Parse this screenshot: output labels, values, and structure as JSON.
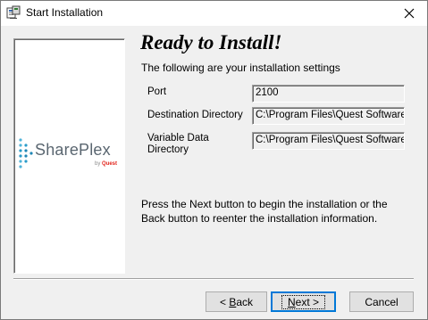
{
  "window": {
    "title": "Start Installation",
    "close_icon": "close-icon",
    "app_icon": "installer-icon"
  },
  "brand": {
    "name": "SharePlex",
    "by": "by",
    "company": "Quest"
  },
  "main": {
    "heading": "Ready to Install!",
    "subheading": "The following are your installation settings",
    "fields": [
      {
        "label": "Port",
        "value": "2100"
      },
      {
        "label": "Destination Directory",
        "value": "C:\\Program Files\\Quest Software\\SharePlex"
      },
      {
        "label": "Variable Data Directory",
        "value": "C:\\Program Files\\Quest Software\\SharePlex"
      }
    ],
    "instructions": "Press the Next button to begin the installation or the Back button to reenter the installation information."
  },
  "buttons": {
    "back": {
      "prefix": "< ",
      "mnemonic": "B",
      "rest": "ack"
    },
    "next": {
      "mnemonic": "N",
      "rest": "ext",
      "suffix": " >"
    },
    "cancel": "Cancel"
  }
}
